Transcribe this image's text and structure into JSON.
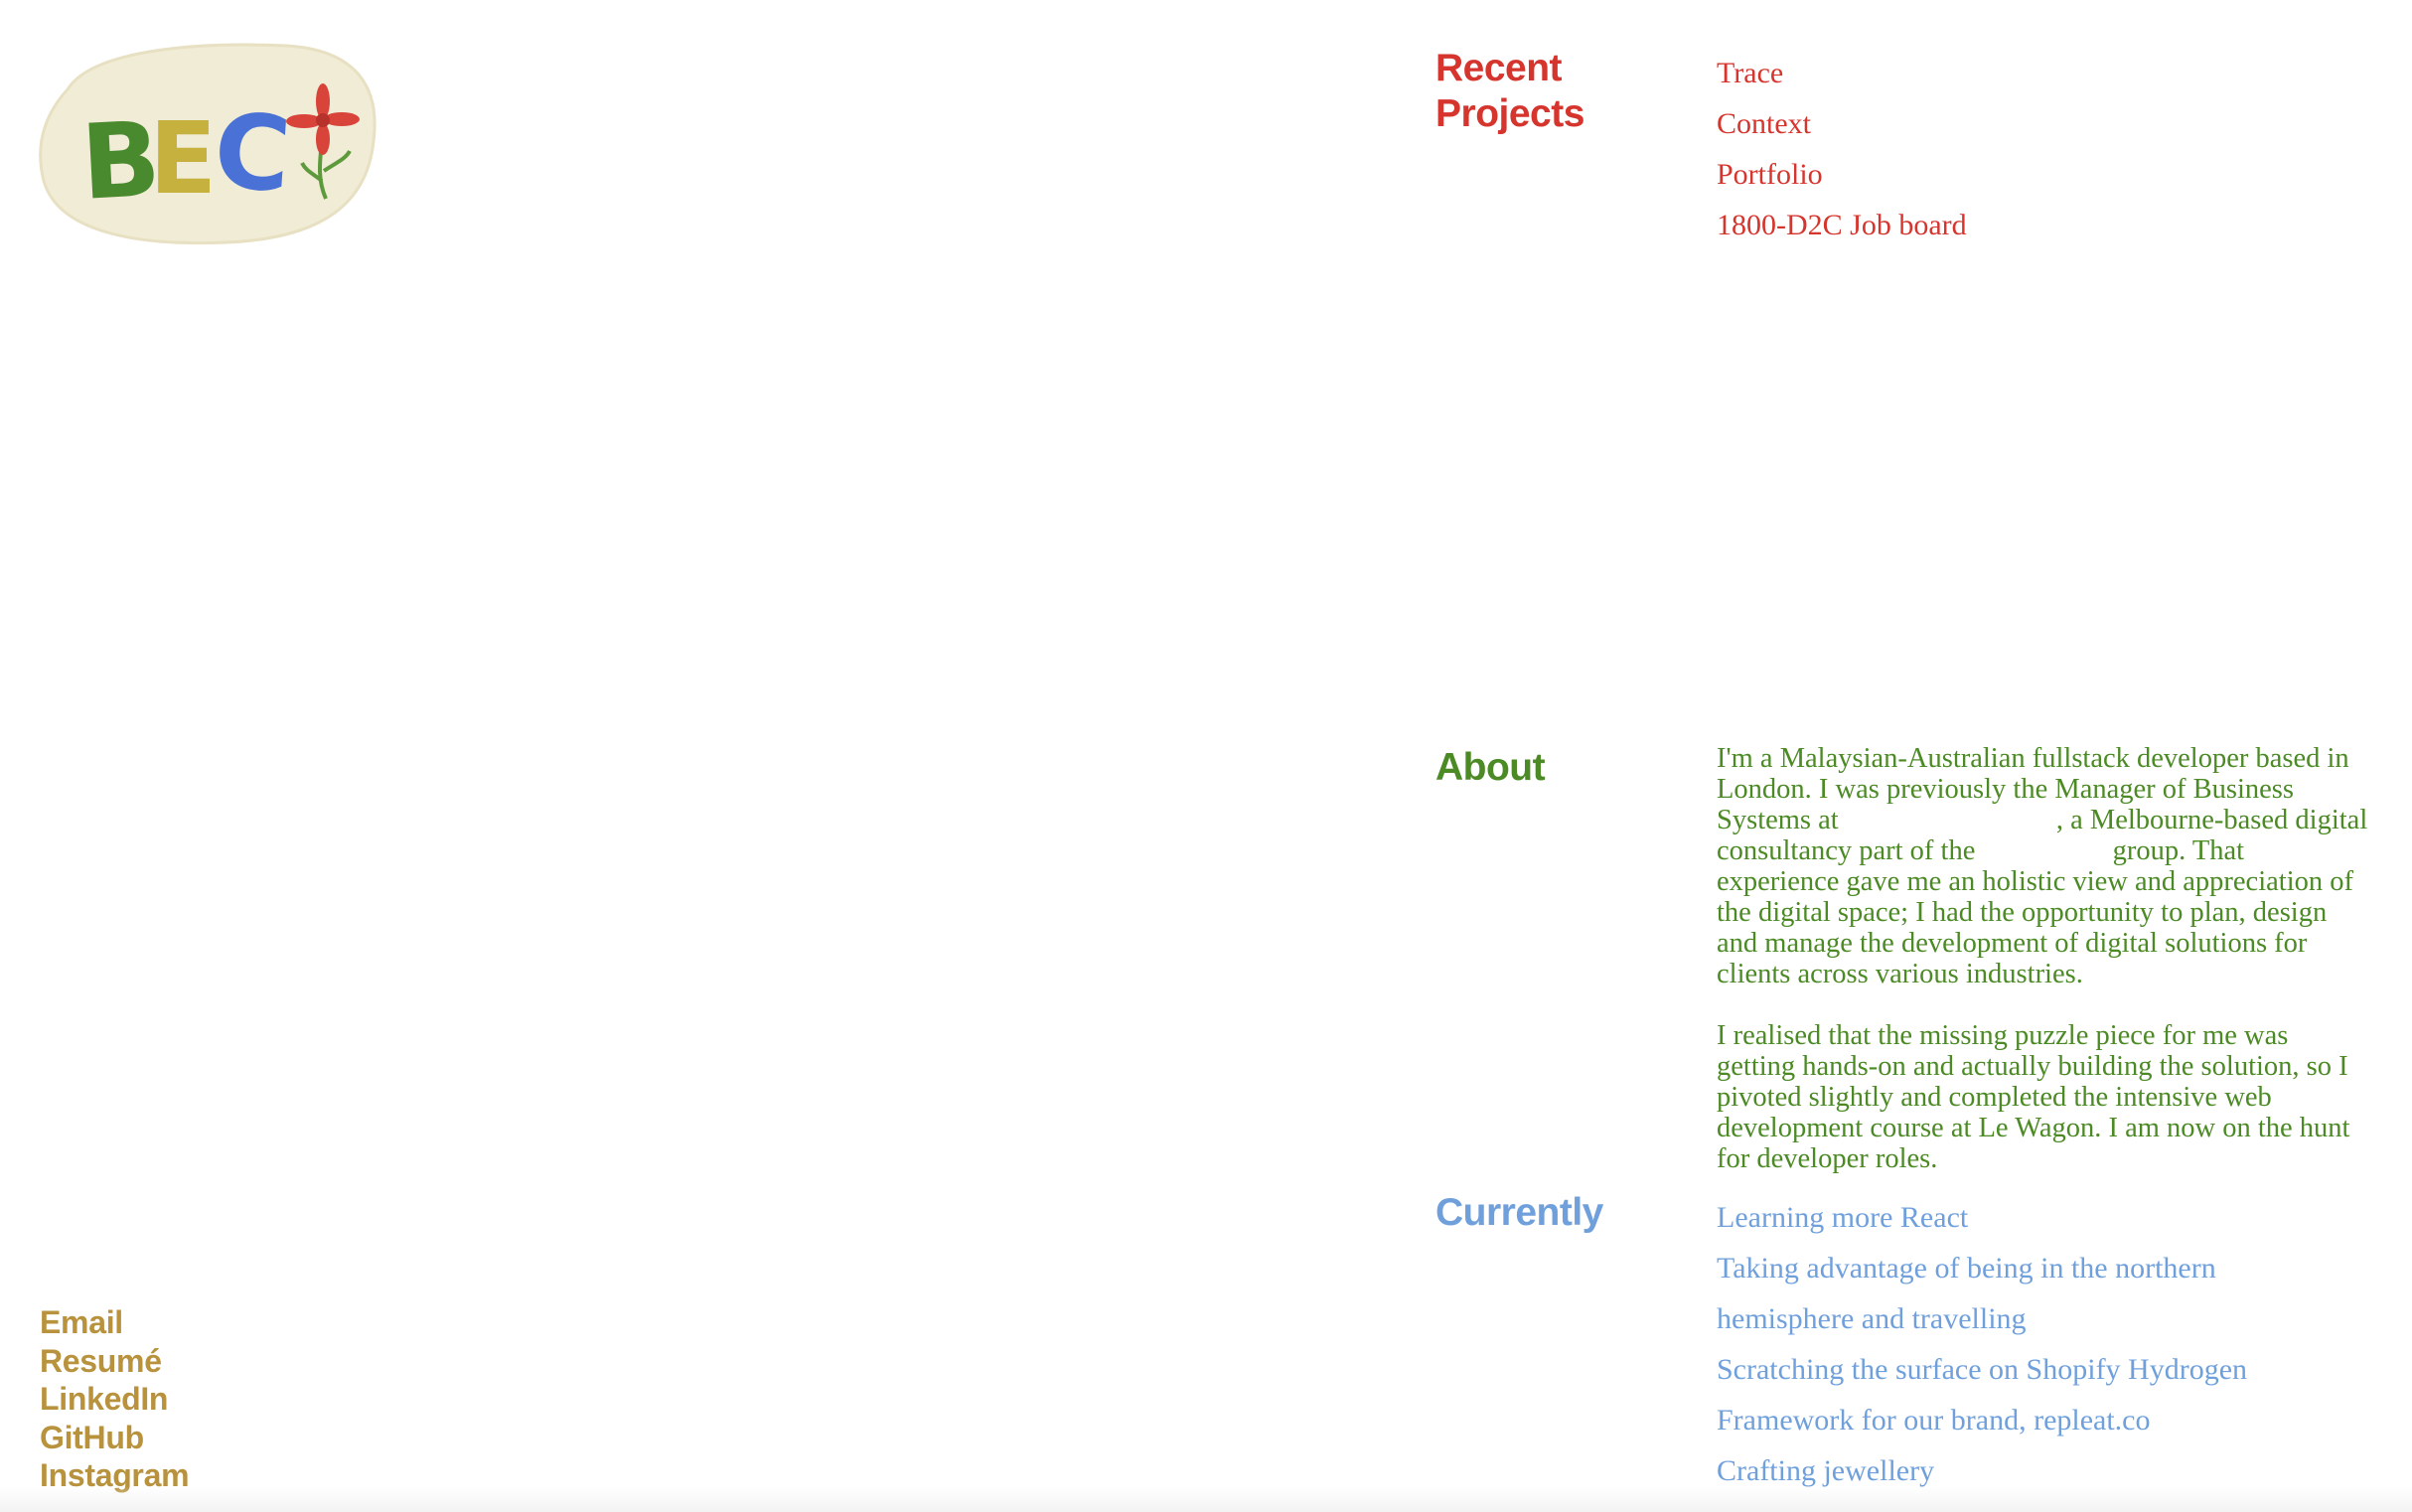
{
  "logo": {
    "text": "BEC",
    "letter_colors": [
      "#4a8a2e",
      "#c6b13e",
      "#4a72d6"
    ],
    "flower_color": "#d9443a",
    "stem_color": "#5d9a3c",
    "blob_color": "#f1ecd6"
  },
  "colors": {
    "projects": "#d6352e",
    "about": "#4b8a24",
    "currently": "#6fa0dc",
    "social": "#b8923d",
    "redaction": "#ffffff"
  },
  "projects": {
    "heading": "Recent Projects",
    "items": [
      "Trace",
      "Context",
      "Portfolio",
      "1800-D2C Job board"
    ]
  },
  "about": {
    "heading": "About",
    "p1_a": "I'm a Malaysian-Australian fullstack developer based in London. I was previously the Manager of Business Systems at",
    "p1_b": ", a Melbourne-based digital consultancy part of the",
    "p1_c": "group. That experience gave me an holistic view and appreciation of the digital space; I had the opportunity to plan, design and manage the development of digital solutions for clients across various industries.",
    "p2": "I realised that the missing puzzle piece for me was getting hands-on and actually building the solution, so I pivoted slightly and completed the intensive web development course at Le Wagon. I am now on the hunt for developer roles."
  },
  "currently": {
    "heading": "Currently",
    "items": [
      "Learning more React",
      "Taking advantage of being in the northern",
      "hemisphere and travelling",
      "Scratching the surface on Shopify Hydrogen",
      "Framework for our brand, repleat.co",
      "Crafting jewellery"
    ]
  },
  "social": {
    "email": "Email",
    "resume": "Resumé",
    "linkedin": "LinkedIn",
    "github": "GitHub",
    "instagram": "Instagram"
  }
}
